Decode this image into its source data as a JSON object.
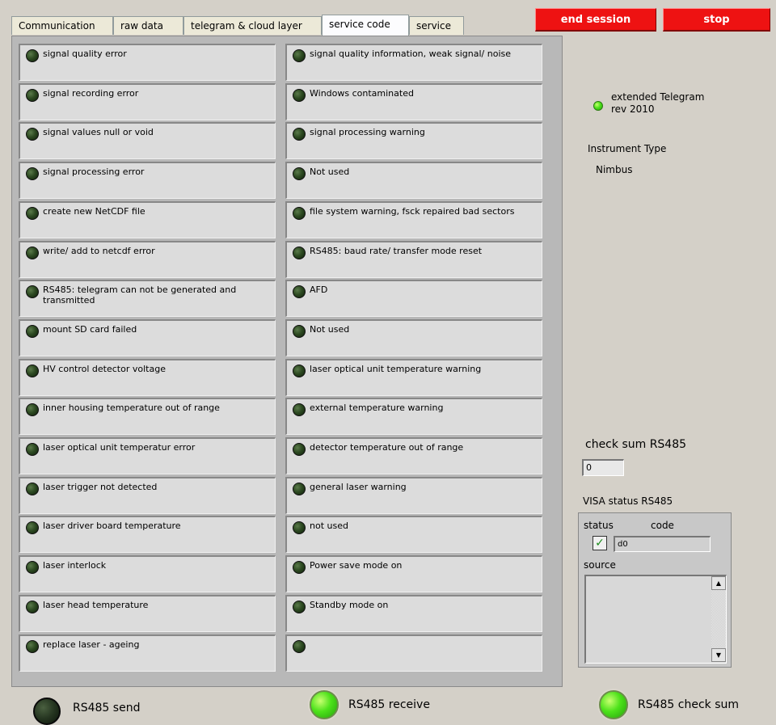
{
  "tabs": [
    {
      "label": "Communication"
    },
    {
      "label": "raw data"
    },
    {
      "label": "telegram & cloud layer"
    },
    {
      "label": "service code",
      "active": true
    },
    {
      "label": "service"
    }
  ],
  "buttons": {
    "end_session": "end session",
    "stop": "stop"
  },
  "left_col": [
    "signal quality error",
    "signal recording error",
    "signal values null or void",
    "signal processing error",
    "create new NetCDF file",
    "write/ add to netcdf error",
    "RS485: telegram can not be generated and transmitted",
    "mount SD card failed",
    "HV control detector voltage",
    "inner housing temperature out of range",
    "laser optical unit temperatur error",
    "laser trigger not detected",
    "laser driver board temperature",
    "laser interlock",
    "laser head temperature",
    "replace laser - ageing"
  ],
  "right_col": [
    "signal quality information,  weak signal/ noise",
    "Windows contaminated",
    "signal processing warning",
    "Not used",
    "file system warning, fsck repaired bad sectors",
    "RS485: baud rate/ transfer mode reset",
    "AFD",
    "Not used",
    "laser optical unit temperature warning",
    "external temperature warning",
    "detector temperature out of range",
    "general laser warning",
    "not used",
    "Power save mode on",
    "Standby mode on",
    ""
  ],
  "right_panel": {
    "extended_telegram": "extended Telegram",
    "extended_telegram_rev": "rev 2010",
    "instrument_type_label": "Instrument Type",
    "instrument_type_value": "Nimbus",
    "checksum_label": "check sum RS485",
    "checksum_value": "0",
    "visa_label": "VISA status RS485",
    "status_label": "status",
    "code_label": "code",
    "code_prefix": "d",
    "code_value": "0",
    "source_label": "source"
  },
  "bottom": {
    "send": "RS485 send",
    "receive": "RS485 receive",
    "checksum": "RS485 check sum"
  },
  "colors": {
    "accent_red": "#ee1212",
    "led_off": "#253520",
    "led_on": "#4ce21a"
  }
}
